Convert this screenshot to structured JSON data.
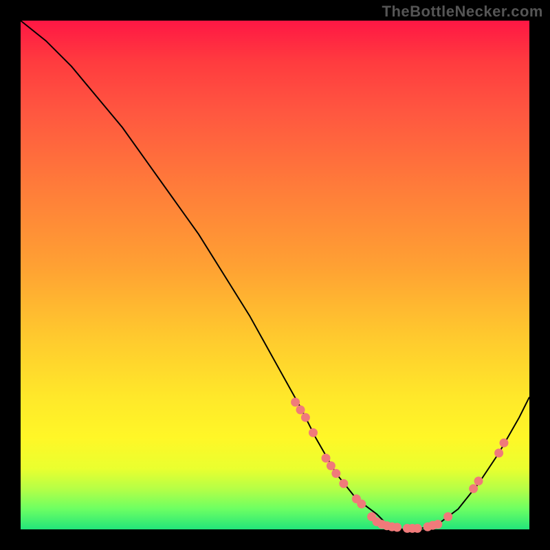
{
  "watermark": "TheBottleNecker.com",
  "colors": {
    "background": "#000000",
    "point": "#f07a7a",
    "curve": "#000000"
  },
  "chart_data": {
    "type": "line",
    "title": "",
    "xlabel": "",
    "ylabel": "",
    "xlim": [
      0,
      100
    ],
    "ylim": [
      0,
      100
    ],
    "grid": false,
    "legend": false,
    "series": [
      {
        "name": "curve",
        "x": [
          0,
          5,
          10,
          15,
          20,
          25,
          30,
          35,
          40,
          45,
          50,
          55,
          58,
          62,
          66,
          70,
          72,
          75,
          78,
          82,
          86,
          90,
          94,
          98,
          100
        ],
        "y": [
          100,
          96,
          91,
          85,
          79,
          72,
          65,
          58,
          50,
          42,
          33,
          24,
          18,
          11,
          6,
          3,
          1,
          0,
          0,
          1,
          4,
          9,
          15,
          22,
          26
        ]
      }
    ],
    "points": [
      {
        "x": 54,
        "y": 25
      },
      {
        "x": 55,
        "y": 23.5
      },
      {
        "x": 56,
        "y": 22
      },
      {
        "x": 57.5,
        "y": 19
      },
      {
        "x": 60,
        "y": 14
      },
      {
        "x": 61,
        "y": 12.5
      },
      {
        "x": 62,
        "y": 11
      },
      {
        "x": 63.5,
        "y": 9
      },
      {
        "x": 66,
        "y": 6
      },
      {
        "x": 67,
        "y": 5
      },
      {
        "x": 69,
        "y": 2.5
      },
      {
        "x": 70,
        "y": 1.5
      },
      {
        "x": 71,
        "y": 1
      },
      {
        "x": 72,
        "y": 0.7
      },
      {
        "x": 73,
        "y": 0.5
      },
      {
        "x": 74,
        "y": 0.4
      },
      {
        "x": 76,
        "y": 0.2
      },
      {
        "x": 77,
        "y": 0.2
      },
      {
        "x": 78,
        "y": 0.2
      },
      {
        "x": 80,
        "y": 0.5
      },
      {
        "x": 81,
        "y": 0.8
      },
      {
        "x": 82,
        "y": 1
      },
      {
        "x": 84,
        "y": 2.5
      },
      {
        "x": 89,
        "y": 8
      },
      {
        "x": 90,
        "y": 9.5
      },
      {
        "x": 94,
        "y": 15
      },
      {
        "x": 95,
        "y": 17
      }
    ]
  }
}
